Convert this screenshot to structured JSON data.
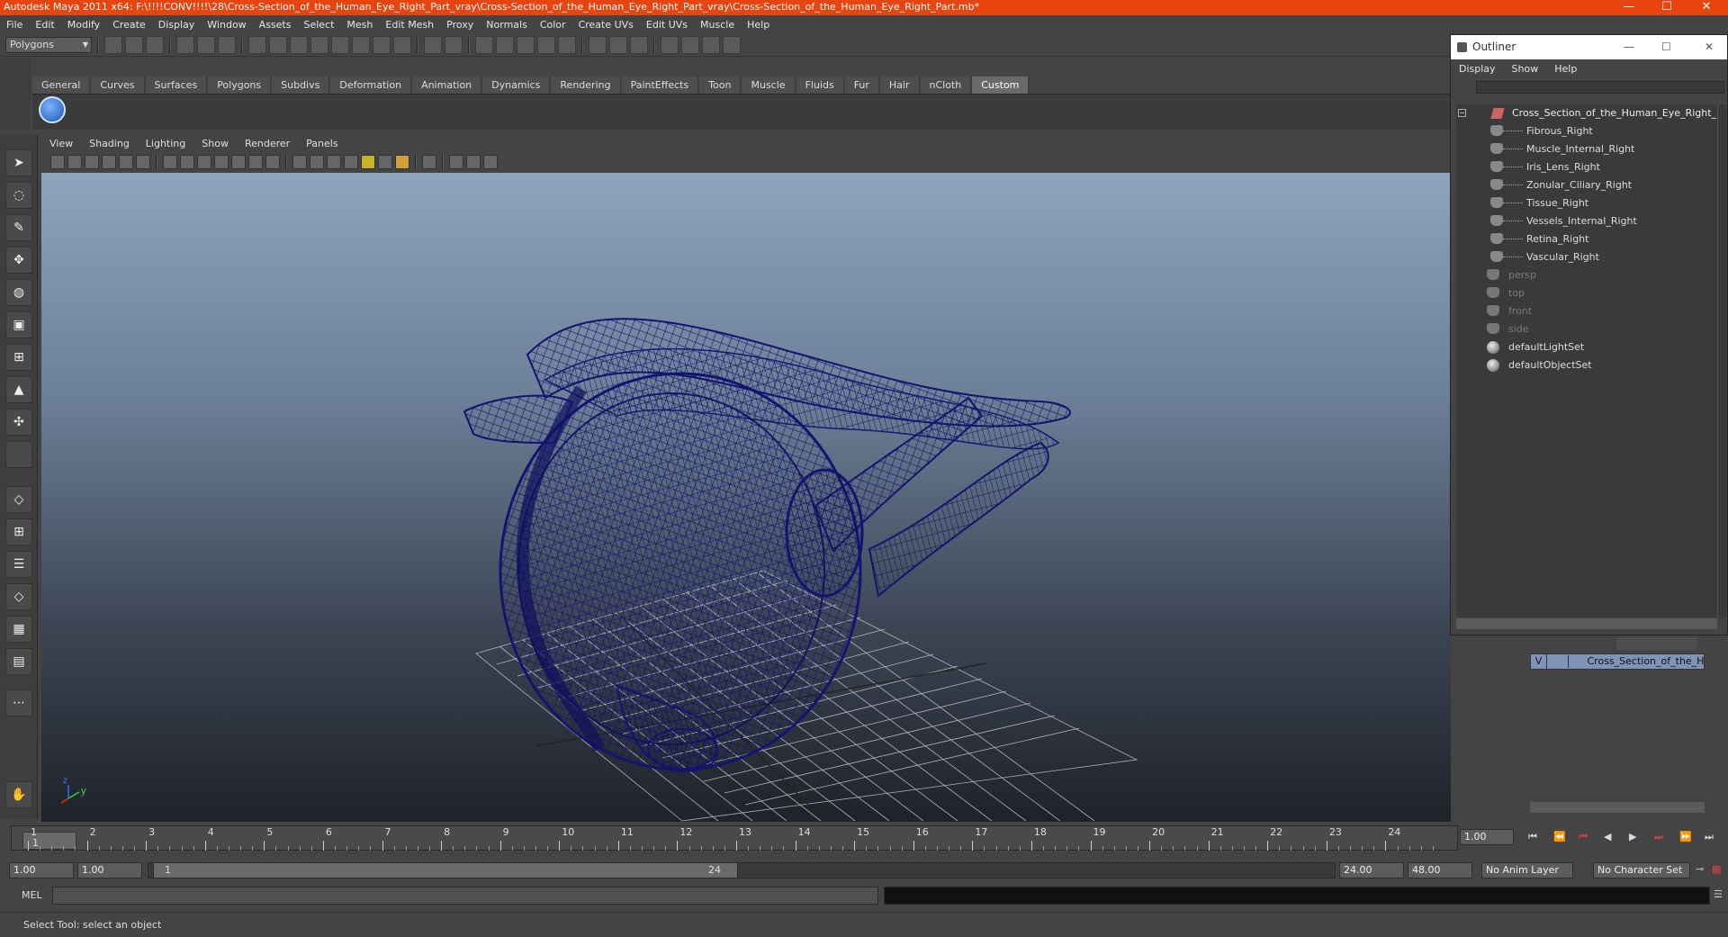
{
  "window": {
    "title": "Autodesk Maya 2011 x64: F:\\!!!!CONV!!!!\\28\\Cross-Section_of_the_Human_Eye_Right_Part_vray\\Cross-Section_of_the_Human_Eye_Right_Part_vray\\Cross-Section_of_the_Human_Eye_Right_Part.mb*",
    "minimize": "—",
    "maximize": "☐",
    "close": "✕"
  },
  "menubar": [
    "File",
    "Edit",
    "Modify",
    "Create",
    "Display",
    "Window",
    "Assets",
    "Select",
    "Mesh",
    "Edit Mesh",
    "Proxy",
    "Normals",
    "Color",
    "Create UVs",
    "Edit UVs",
    "Muscle",
    "Help"
  ],
  "statusline": {
    "mode": "Polygons"
  },
  "shelf": {
    "tabs": [
      "General",
      "Curves",
      "Surfaces",
      "Polygons",
      "Subdivs",
      "Deformation",
      "Animation",
      "Dynamics",
      "Rendering",
      "PaintEffects",
      "Toon",
      "Muscle",
      "Fluids",
      "Fur",
      "Hair",
      "nCloth",
      "Custom"
    ],
    "active_tab": "Custom"
  },
  "panel": {
    "menu": [
      "View",
      "Shading",
      "Lighting",
      "Show",
      "Renderer",
      "Panels"
    ],
    "axis_y": "y",
    "axis_z": "z"
  },
  "outliner": {
    "title": "Outliner",
    "menu": [
      "Display",
      "Show",
      "Help"
    ],
    "root": "Cross_Section_of_the_Human_Eye_Right_Part",
    "children": [
      "Fibrous_Right",
      "Muscle_Internal_Right",
      "Iris_Lens_Right",
      "Zonular_Ciliary_Right",
      "Tissue_Right",
      "Vessels_Internal_Right",
      "Retina_Right",
      "Vascular_Right"
    ],
    "cameras": [
      "persp",
      "top",
      "front",
      "side"
    ],
    "sets": [
      "defaultLightSet",
      "defaultObjectSet"
    ]
  },
  "layers": {
    "visible": "V",
    "name": "Cross_Section_of_the_Human_Eye_Right_Part"
  },
  "timeline": {
    "ticks": [
      "1",
      "2",
      "3",
      "4",
      "5",
      "6",
      "7",
      "8",
      "9",
      "10",
      "11",
      "12",
      "13",
      "14",
      "15",
      "16",
      "17",
      "18",
      "19",
      "20",
      "21",
      "22",
      "23",
      "24"
    ],
    "current_frame": "1",
    "current_time_field": "1.00"
  },
  "range": {
    "start_time": "1.00",
    "playback_start": "1.00",
    "slider_start": "1",
    "slider_end": "24",
    "playback_end": "24.00",
    "end_time": "48.00",
    "anim_layer": "No Anim Layer",
    "character_set": "No Character Set"
  },
  "command": {
    "label": "MEL"
  },
  "help": {
    "text": "Select Tool: select an object"
  },
  "colors": {
    "title_bar": "#e8440f",
    "wireframe": "#1a1a7a",
    "viewport_top": "#8ea3bc",
    "viewport_bottom": "#1f2228"
  }
}
